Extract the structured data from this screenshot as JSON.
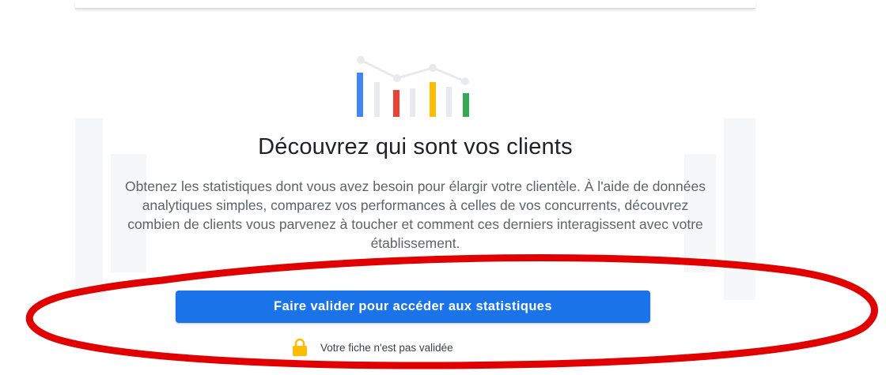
{
  "main": {
    "headline": "Découvrez qui sont vos clients",
    "description": "Obtenez les statistiques dont vous avez besoin pour élargir votre clientèle. À l'aide de données analytiques simples, comparez vos performances à celles de vos concurrents, découvrez combien de clients vous parvenez à toucher et comment ces derniers interagissent avec votre établissement.",
    "primary_button": "Faire valider pour accéder aux statistiques",
    "status_text": "Votre fiche n'est pas validée"
  },
  "icons": {
    "illustration": "bar-chart-illustration-icon",
    "status": "lock-icon"
  },
  "colors": {
    "button": "#1a73e8",
    "annotation": "#e00000",
    "bar_blue": "#4285f4",
    "bar_red": "#ea4335",
    "bar_yellow": "#fbbc04",
    "bar_green": "#34a853",
    "lock": "#fbbc04"
  }
}
